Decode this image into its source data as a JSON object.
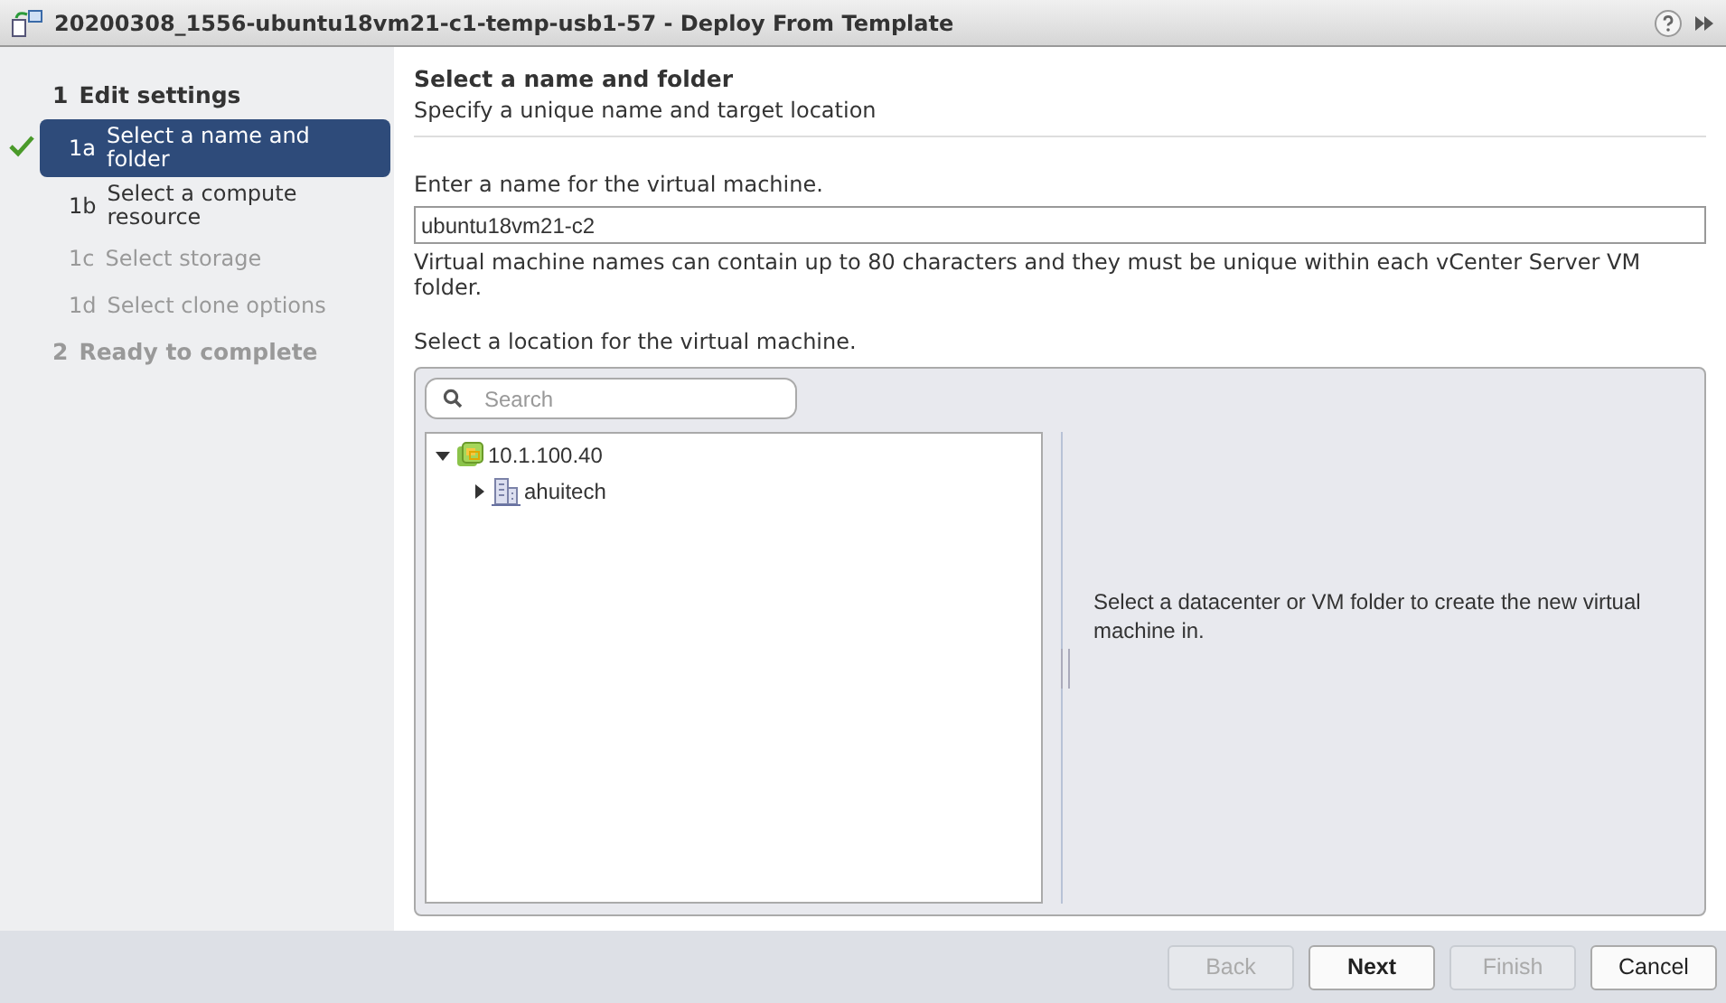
{
  "window": {
    "title": "20200308_1556-ubuntu18vm21-c1-temp-usb1-57 - Deploy From Template"
  },
  "steps": [
    {
      "number": "1",
      "label": "Edit settings",
      "disabled": false,
      "children": [
        {
          "number": "1a",
          "label": "Select a name and folder",
          "selected": true,
          "done": true,
          "disabled": false
        },
        {
          "number": "1b",
          "label": "Select a compute resource",
          "selected": false,
          "done": false,
          "disabled": false
        },
        {
          "number": "1c",
          "label": "Select storage",
          "selected": false,
          "done": false,
          "disabled": true
        },
        {
          "number": "1d",
          "label": "Select clone options",
          "selected": false,
          "done": false,
          "disabled": true
        }
      ]
    },
    {
      "number": "2",
      "label": "Ready to complete",
      "disabled": true
    }
  ],
  "page": {
    "title": "Select a name and folder",
    "subtitle": "Specify a unique name and target location"
  },
  "name_field": {
    "label": "Enter a name for the virtual machine.",
    "value": "ubuntu18vm21-c2",
    "hint": "Virtual machine names can contain up to 80 characters and they must be unique within each vCenter Server VM folder."
  },
  "location": {
    "label": "Select a location for the virtual machine.",
    "search": {
      "placeholder": "Search"
    },
    "tree": [
      {
        "label": "10.1.100.40",
        "kind": "vcenter",
        "expanded": true,
        "children": [
          {
            "label": "ahuitech",
            "kind": "datacenter",
            "expanded": false
          }
        ]
      }
    ],
    "info": "Select a datacenter or VM folder to create the new virtual machine in."
  },
  "buttons": [
    {
      "label": "Back",
      "disabled": true,
      "primary": false
    },
    {
      "label": "Next",
      "disabled": false,
      "primary": true
    },
    {
      "label": "Finish",
      "disabled": true,
      "primary": false
    },
    {
      "label": "Cancel",
      "disabled": false,
      "primary": false
    }
  ]
}
